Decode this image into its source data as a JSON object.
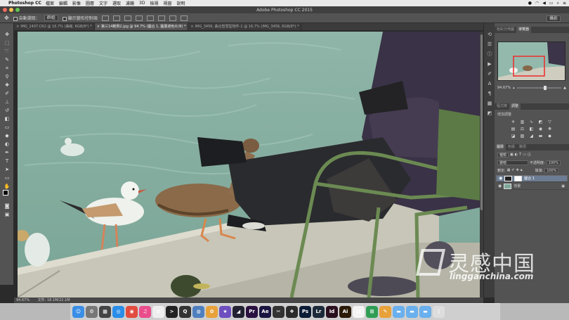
{
  "menubar": {
    "app": "Photoshop CC",
    "items": [
      "檔案",
      "編輯",
      "影像",
      "圖層",
      "文字",
      "選取",
      "濾鏡",
      "3D",
      "檢視",
      "視窗",
      "說明"
    ],
    "right_icons": [
      "notification-icon",
      "wifi-icon",
      "volume-icon",
      "battery-icon",
      "search-icon",
      "menu-list-icon"
    ]
  },
  "window": {
    "title": "Adobe Photoshop CC 2015"
  },
  "options_bar": {
    "auto_select_label": "自動選取：",
    "auto_select_value": "群組",
    "show_transform_label": "顯示變形控制項",
    "workspace": "攝影"
  },
  "doc_tabs": [
    {
      "label": "IMG_1407.CR2 @ 16.7% (曲線, RGB/8*) *",
      "active": false
    },
    {
      "label": "第三14範例2.jpg @ 94.7% (圖合 1, 圖層遮色片/8) *",
      "active": true
    },
    {
      "label": "IMG_3456, 曲合智慧型物件-1 @ 16.7% (IMG_3456, RGB/8*) *",
      "active": false
    }
  ],
  "status_bar": {
    "zoom": "94.67%",
    "doc_size": "文件: 18.1M/22.1M"
  },
  "panels": {
    "top_tabs": [
      "色彩分佈圖",
      "導覽器"
    ],
    "navigator_zoom": "94.67%",
    "adjust_tabs": [
      "程式庫",
      "調整"
    ],
    "adjust_title": "增加調整",
    "layers_tabs": [
      "圖層",
      "色版",
      "路徑"
    ],
    "filter_kind": "種類",
    "blend_mode": "變暗",
    "opacity_label": "不透明度:",
    "opacity_value": "100%",
    "lock_label": "鎖定:",
    "fill_label": "填滿:",
    "fill_value": "100%",
    "layers": [
      {
        "name": "圖合 1",
        "selected": true,
        "type": "adjustment"
      },
      {
        "name": "背景",
        "selected": false,
        "type": "image"
      }
    ]
  },
  "watermark": {
    "cn": "灵感中国",
    "url": "lingganchina.com"
  },
  "dock": {
    "apps": [
      {
        "icon": "finder-icon",
        "color": "#3a8ee6",
        "glyph": "☺"
      },
      {
        "icon": "preferences-icon",
        "color": "#777777",
        "glyph": "⚙"
      },
      {
        "icon": "launchpad-icon",
        "color": "#444444",
        "glyph": "▦"
      },
      {
        "icon": "safari-icon",
        "color": "#2a8de8",
        "glyph": "◎"
      },
      {
        "icon": "chrome-icon",
        "color": "#e24c3f",
        "glyph": "◉"
      },
      {
        "icon": "itunes-icon",
        "color": "#ea4d8c",
        "glyph": "♫"
      },
      {
        "icon": "notes-icon",
        "color": "#eeeeee",
        "glyph": "≡"
      },
      {
        "icon": "terminal-icon",
        "color": "#222222",
        "glyph": ">"
      },
      {
        "icon": "quicktime-icon",
        "color": "#333333",
        "glyph": "Q"
      },
      {
        "icon": "globe-icon",
        "color": "#4f7fbf",
        "glyph": "◍"
      },
      {
        "icon": "photos-icon",
        "color": "#e8a23a",
        "glyph": "✿"
      },
      {
        "icon": "imovie-icon",
        "color": "#6d4fbf",
        "glyph": "★"
      },
      {
        "icon": "motion-icon",
        "color": "#222233",
        "glyph": "◢"
      },
      {
        "icon": "premiere-icon",
        "color": "#2a1140",
        "glyph": "Pr"
      },
      {
        "icon": "aftereffects-icon",
        "color": "#1a1440",
        "glyph": "Ae"
      },
      {
        "icon": "finalcut-icon",
        "color": "#333333",
        "glyph": "✂"
      },
      {
        "icon": "davinci-icon",
        "color": "#2b2b2b",
        "glyph": "❖"
      },
      {
        "icon": "photoshop-icon",
        "color": "#0b1c36",
        "glyph": "Ps"
      },
      {
        "icon": "lightroom-icon",
        "color": "#1c2a3a",
        "glyph": "Lr"
      },
      {
        "icon": "indesign-icon",
        "color": "#2a0f1e",
        "glyph": "Id"
      },
      {
        "icon": "illustrator-icon",
        "color": "#2a1a05",
        "glyph": "Ai"
      },
      {
        "icon": "calendar-icon",
        "color": "#f4f4f4",
        "glyph": "▤"
      },
      {
        "icon": "sheets-icon",
        "color": "#2f9e55",
        "glyph": "⊞"
      },
      {
        "icon": "pages-icon",
        "color": "#e8a23a",
        "glyph": "✎"
      },
      {
        "icon": "folder-icon",
        "color": "#6ab0ee",
        "glyph": "▬"
      },
      {
        "icon": "downloads-icon",
        "color": "#6ab0ee",
        "glyph": "▬"
      },
      {
        "icon": "folder-icon",
        "color": "#6ab0ee",
        "glyph": "▬"
      },
      {
        "icon": "trash-icon",
        "color": "#dddddd",
        "glyph": "▯"
      }
    ]
  }
}
